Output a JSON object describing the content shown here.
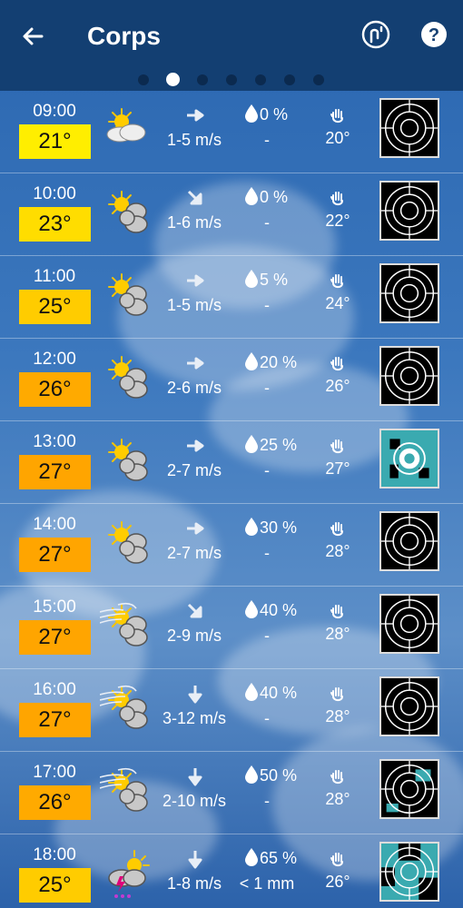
{
  "header": {
    "title": "Corps",
    "back_icon": "arrow-left-icon",
    "map_icon": "map-pin-icon",
    "help_icon": "help-icon",
    "pages": 7,
    "active_page": 1
  },
  "colors": {
    "header_bg": "#133f72",
    "temp_yellow": "#ffee00",
    "temp_gold": "#ffcc00",
    "temp_orange": "#ffa500",
    "uv_teal": "#3aaab0"
  },
  "rows": [
    {
      "time": "09:00",
      "temp": "21°",
      "temp_color": "#ffee00",
      "weather_icon": "partly-sunny-icon",
      "wind_dir": "east",
      "wind": "1-5 m/s",
      "precip_chance": "0 %",
      "rain": "-",
      "feels": "20°",
      "uv": "none"
    },
    {
      "time": "10:00",
      "temp": "23°",
      "temp_color": "#ffdd00",
      "weather_icon": "sun-cloud-icon",
      "wind_dir": "southeast",
      "wind": "1-6 m/s",
      "precip_chance": "0 %",
      "rain": "-",
      "feels": "22°",
      "uv": "none"
    },
    {
      "time": "11:00",
      "temp": "25°",
      "temp_color": "#ffcc00",
      "weather_icon": "sun-cloud-icon",
      "wind_dir": "east",
      "wind": "1-5 m/s",
      "precip_chance": "5 %",
      "rain": "-",
      "feels": "24°",
      "uv": "none"
    },
    {
      "time": "12:00",
      "temp": "26°",
      "temp_color": "#ffaa00",
      "weather_icon": "sun-cloud-icon",
      "wind_dir": "east",
      "wind": "2-6 m/s",
      "precip_chance": "20 %",
      "rain": "-",
      "feels": "26°",
      "uv": "none"
    },
    {
      "time": "13:00",
      "temp": "27°",
      "temp_color": "#ffa500",
      "weather_icon": "sun-cloud-icon",
      "wind_dir": "east",
      "wind": "2-7 m/s",
      "precip_chance": "25 %",
      "rain": "-",
      "feels": "27°",
      "uv": "teal"
    },
    {
      "time": "14:00",
      "temp": "27°",
      "temp_color": "#ffa500",
      "weather_icon": "sun-cloud-icon",
      "wind_dir": "east",
      "wind": "2-7 m/s",
      "precip_chance": "30 %",
      "rain": "-",
      "feels": "28°",
      "uv": "none"
    },
    {
      "time": "15:00",
      "temp": "27°",
      "temp_color": "#ffa500",
      "weather_icon": "windy-sun-cloud-icon",
      "wind_dir": "southeast",
      "wind": "2-9 m/s",
      "precip_chance": "40 %",
      "rain": "-",
      "feels": "28°",
      "uv": "none"
    },
    {
      "time": "16:00",
      "temp": "27°",
      "temp_color": "#ffa500",
      "weather_icon": "windy-sun-cloud-icon",
      "wind_dir": "south",
      "wind": "3-12 m/s",
      "precip_chance": "40 %",
      "rain": "-",
      "feels": "28°",
      "uv": "none"
    },
    {
      "time": "17:00",
      "temp": "26°",
      "temp_color": "#ffaa00",
      "weather_icon": "windy-sun-cloud-icon",
      "wind_dir": "south",
      "wind": "2-10 m/s",
      "precip_chance": "50 %",
      "rain": "-",
      "feels": "28°",
      "uv": "partial"
    },
    {
      "time": "18:00",
      "temp": "25°",
      "temp_color": "#ffcc00",
      "weather_icon": "thunderstorm-icon",
      "wind_dir": "south",
      "wind": "1-8 m/s",
      "precip_chance": "65 %",
      "rain": "< 1 mm",
      "feels": "26°",
      "uv": "teal-partial"
    }
  ]
}
